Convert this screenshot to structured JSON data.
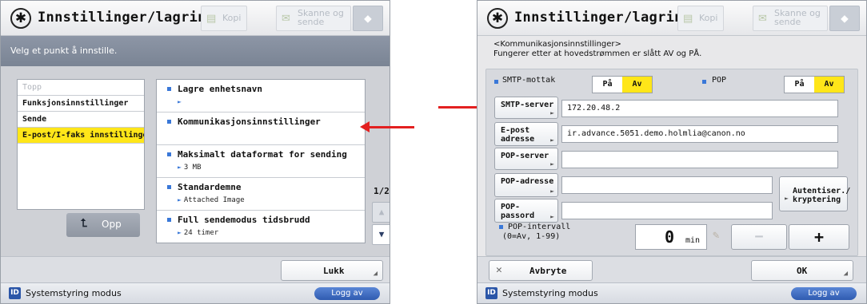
{
  "left_screen": {
    "header": {
      "title": "Innstillinger/lagring",
      "kopi": "Kopi",
      "skanne": "Skanne og sende"
    },
    "instruction": "Velg et punkt å innstille.",
    "categories": [
      {
        "label": "Topp"
      },
      {
        "label": "Funksjonsinnstillinger"
      },
      {
        "label": "Sende"
      },
      {
        "label": "E-post/I-faks innstillinger",
        "selected": true
      }
    ],
    "opp_label": "Opp",
    "settings": [
      {
        "name": "Lagre enhetsnavn",
        "value": ""
      },
      {
        "name": "Kommunikasjonsinnstillinger",
        "value": ""
      },
      {
        "name": "Maksimalt dataformat for sending",
        "value": "3 MB"
      },
      {
        "name": "Standardemne",
        "value": "Attached Image"
      },
      {
        "name": "Full sendemodus tidsbrudd",
        "value": "24 timer"
      }
    ],
    "page_indicator": "1/2",
    "close_label": "Lukk",
    "status": {
      "text": "Systemstyring modus",
      "logout": "Logg av",
      "id_badge": "ID"
    }
  },
  "right_screen": {
    "header": {
      "title": "Innstillinger/lagring",
      "kopi": "Kopi",
      "skanne": "Skanne og sende"
    },
    "info_line1": "<Kommunikasjonsinnstillinger>",
    "info_line2": "Fungerer etter at hovedstrømmen er slått AV og PÅ.",
    "smtp_mottak": {
      "label": "SMTP-mottak",
      "on": "På",
      "off": "Av",
      "selected": "off"
    },
    "pop": {
      "label": "POP",
      "on": "På",
      "off": "Av",
      "selected": "off"
    },
    "fields": {
      "smtp_server": {
        "label": "SMTP-server",
        "value": "172.20.48.2"
      },
      "email_address": {
        "label_line1": "E-post",
        "label_line2": "adresse",
        "value": "ir.advance.5051.demo.holmlia@canon.no"
      },
      "pop_server": {
        "label": "POP-server",
        "value": ""
      },
      "pop_address": {
        "label": "POP-adresse",
        "value": ""
      },
      "pop_password": {
        "label_line1": "POP-",
        "label_line2": "passord",
        "value": ""
      }
    },
    "auth_button": {
      "line1": "Autentiser./",
      "line2": "kryptering"
    },
    "pop_interval": {
      "label_line1": "POP-intervall",
      "label_line2": "(0=Av, 1-99)",
      "value": "0",
      "unit": "min"
    },
    "cancel_label": "Avbryte",
    "ok_label": "OK",
    "status": {
      "text": "Systemstyring modus",
      "logout": "Logg av",
      "id_badge": "ID"
    }
  },
  "colors": {
    "selected_yellow": "#ffe619",
    "accent_blue": "#3a78d8",
    "annotation_red": "#e32020"
  }
}
